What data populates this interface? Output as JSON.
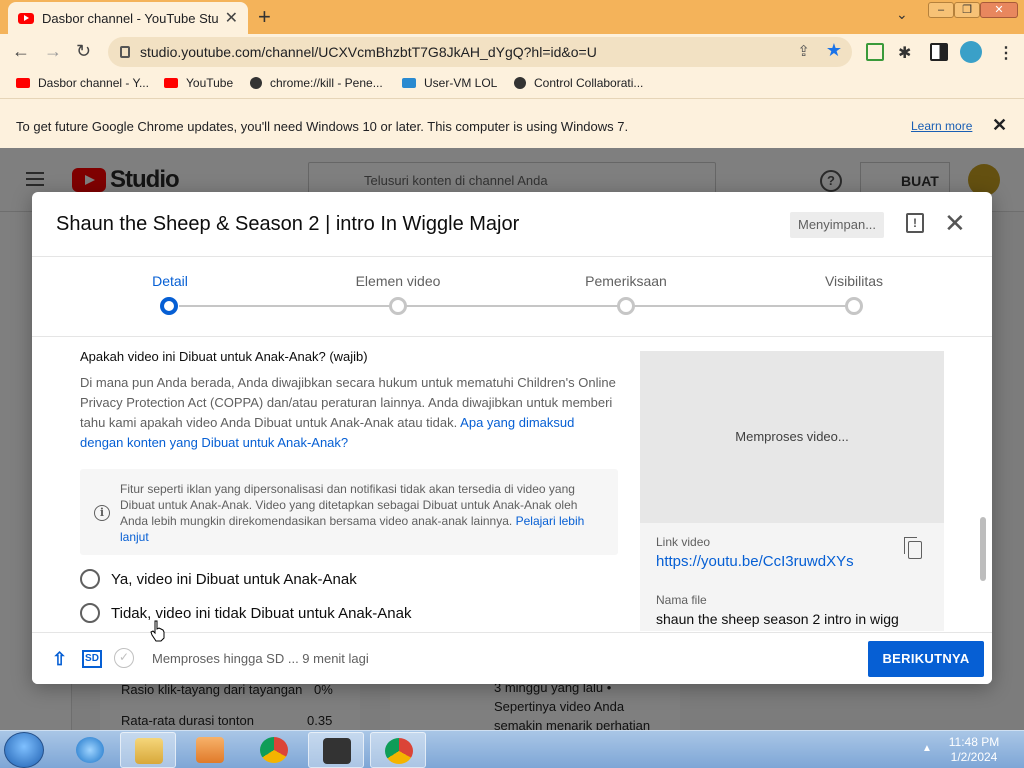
{
  "browser": {
    "tab_title": "Dasbor channel - YouTube Studio",
    "tab_close": "✕",
    "new_tab": "+",
    "tab_menu": "⌄",
    "url": "studio.youtube.com/channel/UCXVcmBhzbtT7G8JkAH_dYgQ?hl=id&o=U",
    "bookmarks": [
      {
        "label": "Dasbor channel - Y...",
        "icon": "youtube-icon"
      },
      {
        "label": "YouTube",
        "icon": "youtube-icon"
      },
      {
        "label": "chrome://kill - Pene...",
        "icon": "globe-icon"
      },
      {
        "label": "User-VM LOL",
        "icon": "monitor-icon"
      },
      {
        "label": "Control Collaborati...",
        "icon": "globe-icon"
      }
    ],
    "infobar_message": "To get future Google Chrome updates, you'll need Windows 10 or later. This computer is using Windows 7.",
    "infobar_link": "Learn more",
    "infobar_close": "✕"
  },
  "studio": {
    "logo_text": "Studio",
    "search_placeholder": "Telusuri konten di channel Anda",
    "create_label": "BUAT",
    "help": "?"
  },
  "background": {
    "row1_label": "Rasio klik-tayang dari tayangan",
    "row1_value": "0%",
    "row2_label": "Rata-rata durasi tonton",
    "row2_value": "0.35",
    "side_line1": "3 minggu yang lalu •",
    "side_line2": "Sepertinya video Anda",
    "side_line3": "semakin menarik perhatian"
  },
  "modal": {
    "title": "Shaun the Sheep & Season 2 | intro In Wiggle Major",
    "saving": "Menyimpan...",
    "feedback": "!",
    "close": "✕",
    "steps": [
      {
        "label": "Detail",
        "active": true
      },
      {
        "label": "Elemen video",
        "active": false
      },
      {
        "label": "Pemeriksaan",
        "active": false
      },
      {
        "label": "Visibilitas",
        "active": false
      }
    ],
    "question": "Apakah video ini Dibuat untuk Anak-Anak? (wajib)",
    "description": "Di mana pun Anda berada, Anda diwajibkan secara hukum untuk mematuhi Children's Online Privacy Protection Act (COPPA) dan/atau peraturan lainnya. Anda diwajibkan untuk memberi tahu kami apakah video Anda Dibuat untuk Anak-Anak atau tidak.",
    "description_link": "Apa yang dimaksud dengan konten yang Dibuat untuk Anak-Anak?",
    "info_icon": "i",
    "info_text": "Fitur seperti iklan yang dipersonalisasi dan notifikasi tidak akan tersedia di video yang Dibuat untuk Anak-Anak. Video yang ditetapkan sebagai Dibuat untuk Anak-Anak oleh Anda lebih mungkin direkomendasikan bersama video anak-anak lainnya.",
    "info_link": "Pelajari lebih lanjut",
    "radio_yes": "Ya, video ini Dibuat untuk Anak-Anak",
    "radio_no": "Tidak, video ini tidak Dibuat untuk Anak-Anak",
    "preview_status": "Memproses video...",
    "link_label": "Link video",
    "link_url": "https://youtu.be/CcI3ruwdXYs",
    "filename_label": "Nama file",
    "filename": "shaun the sheep season 2 intro in wigg",
    "footer_upload": "⇧",
    "footer_sd": "SD",
    "footer_check": "✓",
    "footer_status": "Memproses hingga SD ... 9 menit lagi",
    "next_button": "BERIKUTNYA"
  },
  "taskbar": {
    "time": "11:48 PM",
    "date": "1/2/2024",
    "tray_arrow": "▲"
  },
  "colors": {
    "chrome_frame": "#f4b35a",
    "youtube_red": "#ff0000",
    "accent_blue": "#065fd4"
  }
}
